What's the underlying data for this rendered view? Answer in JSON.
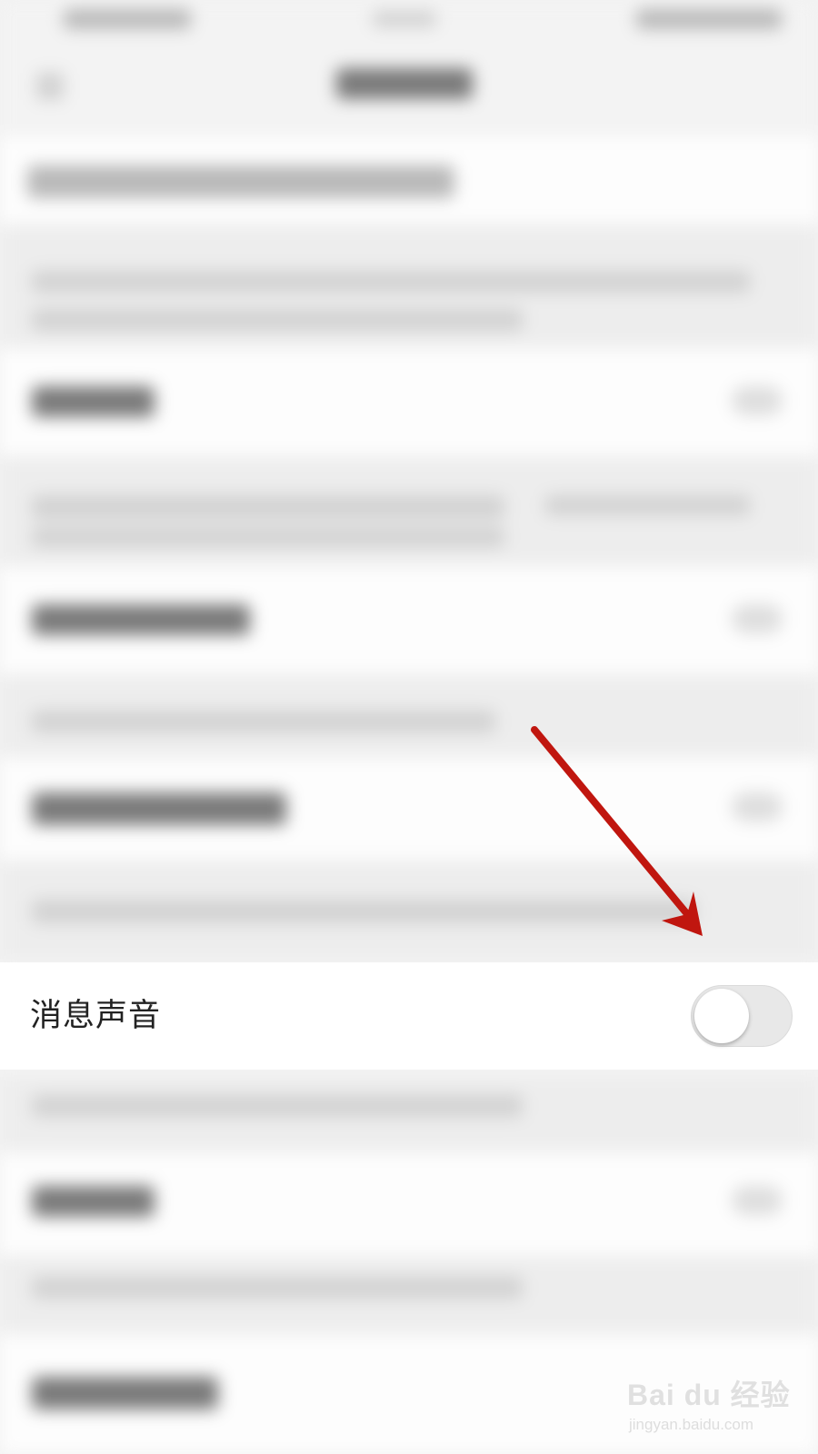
{
  "setting": {
    "label": "消息声音",
    "toggle_on": false
  },
  "colors": {
    "arrow": "#c0160f",
    "toggle_off_track": "#e8e8e8",
    "toggle_knob": "#ffffff"
  },
  "icons": [
    "switch-toggle",
    "annotation-arrow"
  ],
  "watermark": {
    "brand": "Bai du 经验",
    "url": "jingyan.baidu.com"
  }
}
